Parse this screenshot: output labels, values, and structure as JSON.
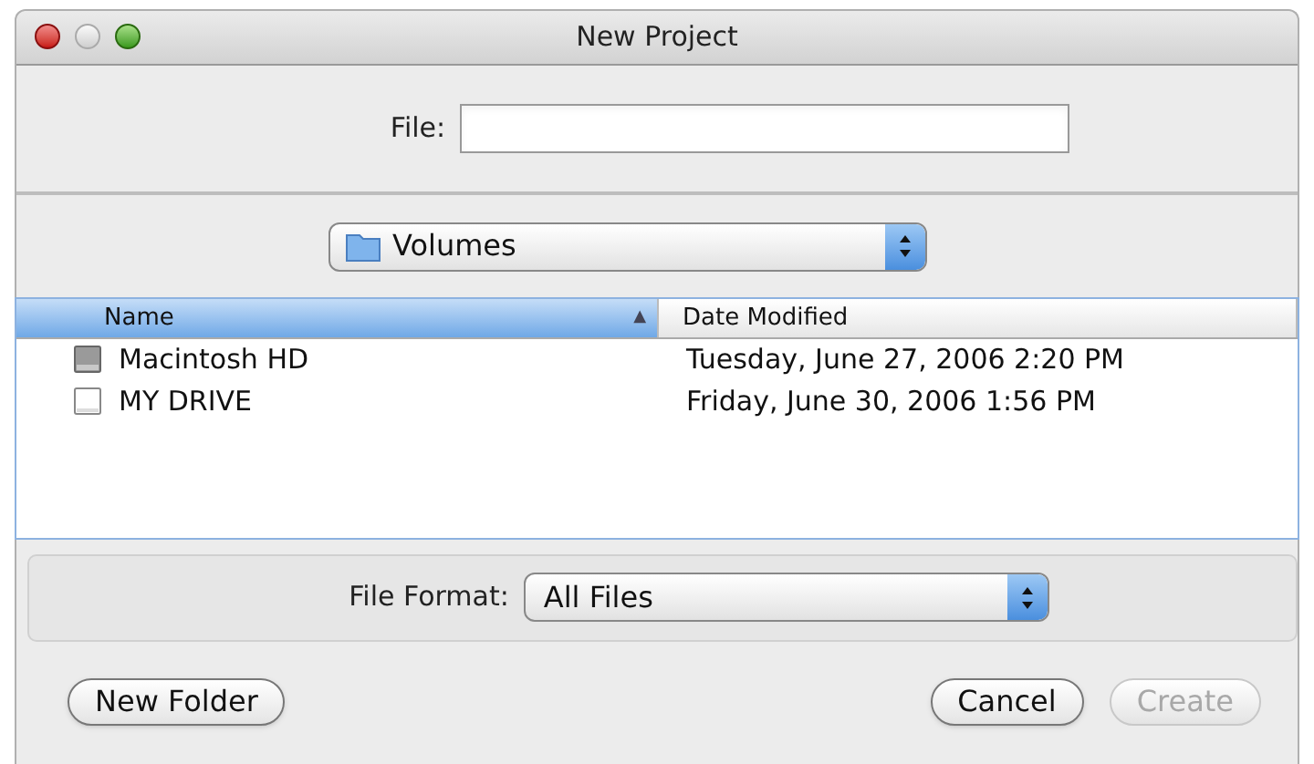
{
  "window": {
    "title": "New Project"
  },
  "file_field": {
    "label": "File:"
  },
  "location_popup": {
    "value": "Volumes"
  },
  "table": {
    "columns": [
      {
        "label": "Name",
        "selected": true,
        "sort": "▲"
      },
      {
        "label": "Date Modified",
        "selected": false
      }
    ],
    "rows": [
      {
        "name": "Macintosh HD",
        "kind": "hard-drive",
        "date": "Tuesday, June 27, 2006 2:20 PM"
      },
      {
        "name": "MY DRIVE",
        "kind": "removable-drive",
        "date": "Friday, June 30, 2006 1:56 PM"
      }
    ]
  },
  "file_format": {
    "label": "File Format:",
    "value": "All Files"
  },
  "buttons": [
    {
      "label": "New Folder",
      "disabled": false
    },
    {
      "label": "Cancel",
      "disabled": false
    },
    {
      "label": "Create",
      "disabled": true
    }
  ]
}
